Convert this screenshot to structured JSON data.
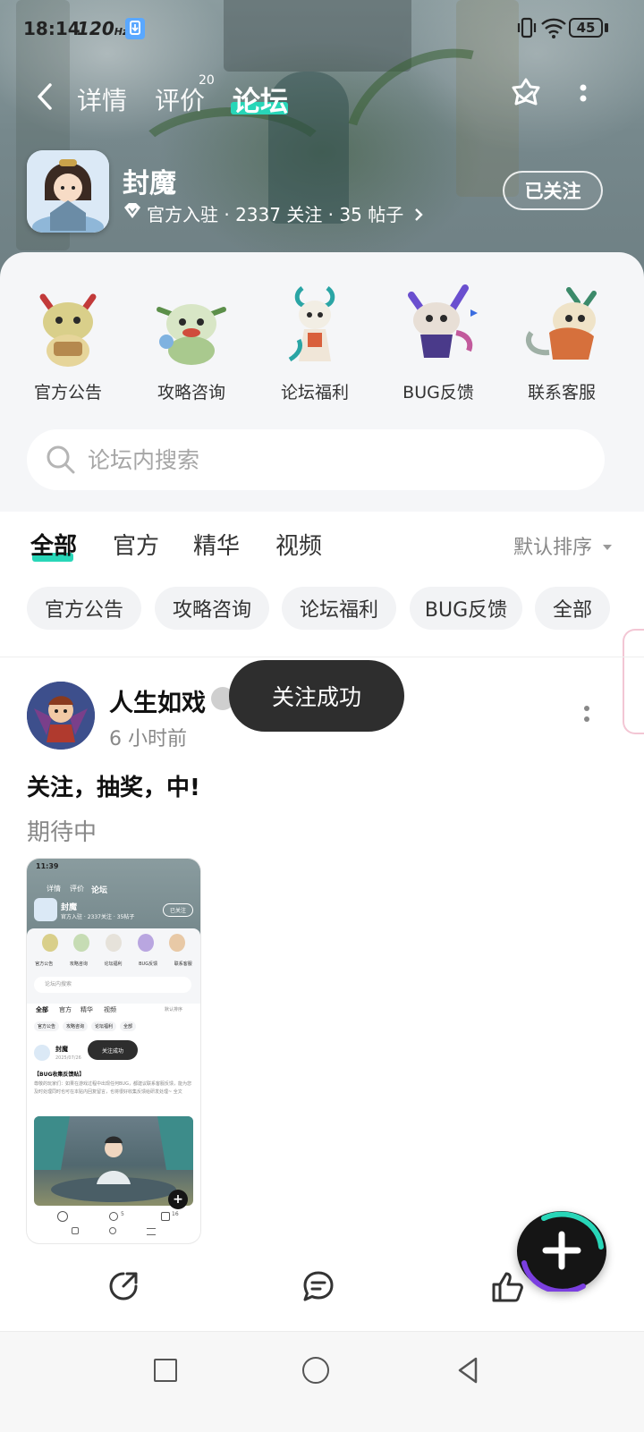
{
  "status_bar": {
    "time": "18:14",
    "refresh_rate": "120",
    "refresh_unit": "Hz",
    "battery": "45"
  },
  "header": {
    "tabs": [
      {
        "label": "详情"
      },
      {
        "label": "评价",
        "badge": "20"
      },
      {
        "label": "论坛",
        "active": true
      }
    ]
  },
  "forum": {
    "name": "封魔",
    "meta": "官方入驻 · 2337 关注 · 35 帖子",
    "follow_label": "已关注"
  },
  "categories": [
    {
      "label": "官方公告"
    },
    {
      "label": "攻略咨询"
    },
    {
      "label": "论坛福利"
    },
    {
      "label": "BUG反馈"
    },
    {
      "label": "联系客服"
    }
  ],
  "search": {
    "placeholder": "论坛内搜索"
  },
  "tabs": [
    {
      "label": "全部",
      "active": true
    },
    {
      "label": "官方"
    },
    {
      "label": "精华"
    },
    {
      "label": "视频"
    }
  ],
  "sort_label": "默认排序",
  "chips": [
    {
      "label": "官方公告"
    },
    {
      "label": "攻略咨询"
    },
    {
      "label": "论坛福利"
    },
    {
      "label": "BUG反馈"
    },
    {
      "label": "全部"
    }
  ],
  "toast": "关注成功",
  "post": {
    "username": "人生如戏",
    "time": "6 小时前",
    "title": "关注，抽奖，中!",
    "body": "期待中"
  },
  "thumbnail": {
    "status_time": "11:39",
    "tabs": [
      "详情",
      "评价",
      "论坛"
    ],
    "forum_name": "封魔",
    "forum_meta": "官方入驻 · 2337关注 · 35帖子",
    "follow_label": "已关注",
    "categories": [
      "官方公告",
      "攻略咨询",
      "论坛福利",
      "BUG反馈",
      "联系客服"
    ],
    "search_placeholder": "论坛内搜索",
    "filter_tabs": [
      "全部",
      "官方",
      "精华",
      "视频"
    ],
    "sort_label": "默认排序",
    "chips": [
      "官方公告",
      "攻略咨询",
      "论坛福利",
      "全部"
    ],
    "post_user": "封魔",
    "post_date": "2025/07/26",
    "toast": "关注成功",
    "post_title": "【BUG收集反馈贴】",
    "post_body": "尊敬的玩家们：如果在游戏过程中出现任何BUG，都建议联系客服反馈，能为您及时处理同时也可在本贴内回复留言，也将很好收集反馈给研发处理~",
    "expand_label": "全文",
    "comments": "5",
    "likes": "16"
  },
  "colors": {
    "accent": "#28d6b8",
    "toast_bg": "#2e2e2e",
    "chip_bg": "#f2f3f5",
    "fab_bg": "#151515"
  }
}
